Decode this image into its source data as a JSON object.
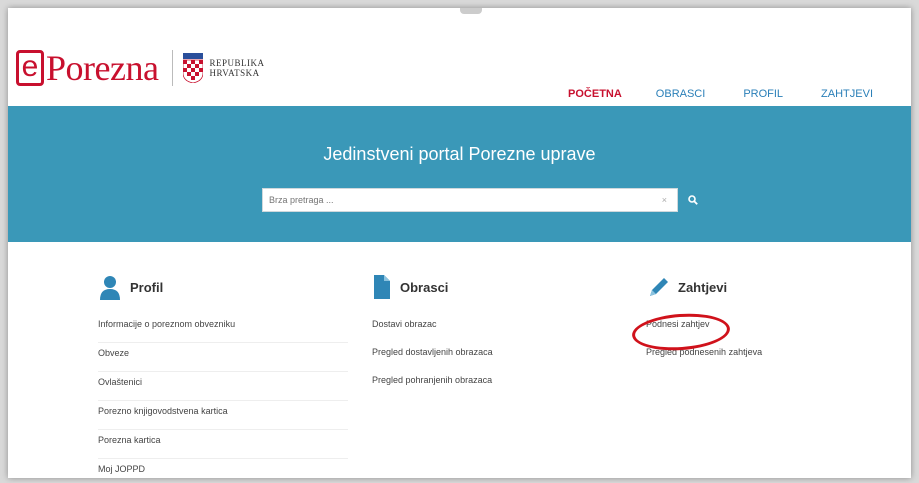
{
  "brand": {
    "logo_letter": "e",
    "logo_name": "Porezna",
    "state_line1": "REPUBLIKA",
    "state_line2": "HRVATSKA",
    "color": "#c8102e"
  },
  "nav": {
    "items": [
      {
        "label": "POČETNA",
        "active": true
      },
      {
        "label": "OBRASCI",
        "active": false
      },
      {
        "label": "PROFIL",
        "active": false
      },
      {
        "label": "ZAHTJEVI",
        "active": false
      }
    ]
  },
  "banner": {
    "title": "Jedinstveni portal Porezne uprave",
    "color": "#3a98b8"
  },
  "search": {
    "placeholder": "Brza pretraga ...",
    "clear_glyph": "×",
    "icon": "search-icon"
  },
  "columns": {
    "profil": {
      "title": "Profil",
      "icon": "user-icon",
      "links": [
        "Informacije o poreznom obvezniku",
        "Obveze",
        "Ovlaštenici",
        "Porezno knjigovodstvena kartica",
        "Porezna kartica",
        "Moj JOPPD"
      ]
    },
    "obrasci": {
      "title": "Obrasci",
      "icon": "document-icon",
      "links": [
        "Dostavi obrazac",
        "Pregled dostavljenih obrazaca",
        "Pregled pohranjenih obrazaca"
      ]
    },
    "zahtjevi": {
      "title": "Zahtjevi",
      "icon": "pencil-icon",
      "links": [
        "Podnesi zahtjev",
        "Pregled podnesenih zahtjeva"
      ]
    }
  },
  "annotation": {
    "highlighted_link": "Podnesi zahtjev",
    "ring_color": "#d0121b"
  }
}
